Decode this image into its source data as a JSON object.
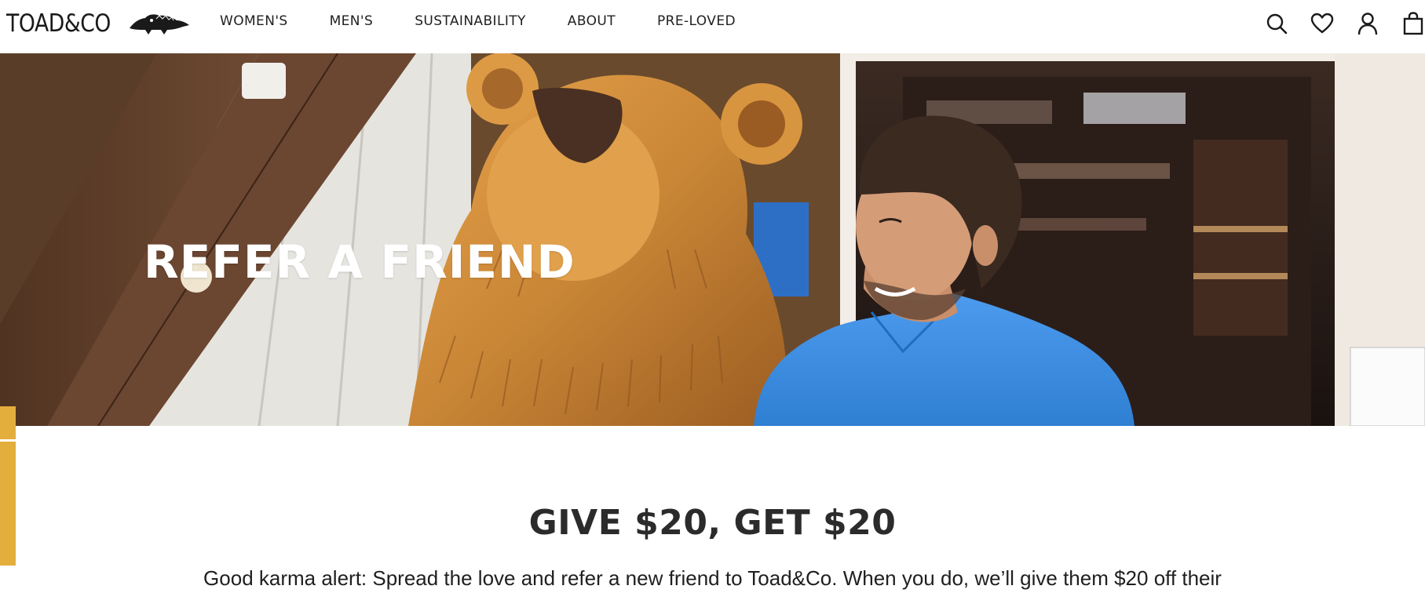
{
  "header": {
    "logo_text": "TOAD&CO",
    "nav": [
      {
        "label": "WOMEN'S"
      },
      {
        "label": "MEN'S"
      },
      {
        "label": "SUSTAINABILITY"
      },
      {
        "label": "ABOUT"
      },
      {
        "label": "PRE-LOVED"
      }
    ],
    "icons": [
      "search-icon",
      "heart-icon",
      "account-icon",
      "bag-icon"
    ]
  },
  "hero": {
    "title": "REFER A FRIEND"
  },
  "promo": {
    "title": "GIVE $20, GET $20",
    "body": "Good karma alert: Spread the love and refer a new friend to Toad&Co. When you do, we’ll give them $20 off their"
  },
  "colors": {
    "accent": "#e3ae3c",
    "text": "#2b2b2b",
    "shirt": "#3f8fe0",
    "wood": "#c98636"
  }
}
